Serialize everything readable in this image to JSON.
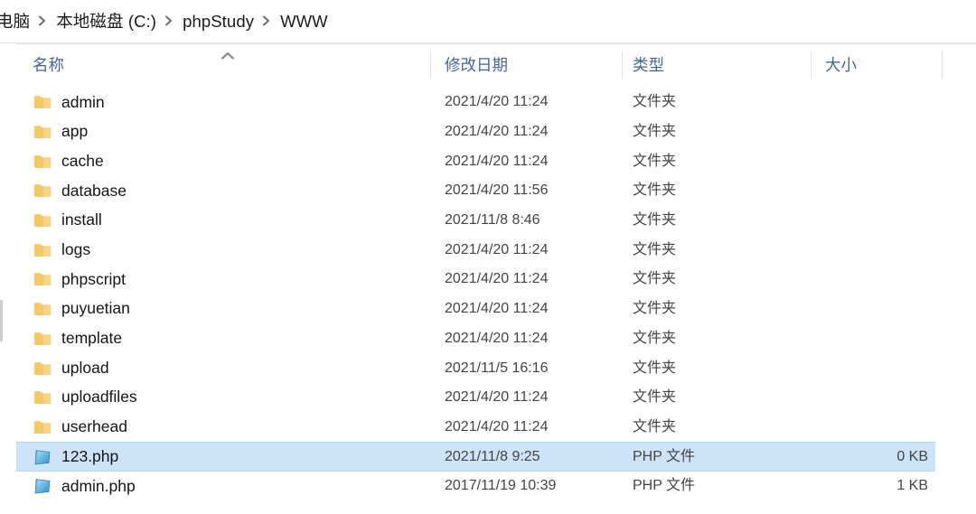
{
  "window": {
    "kind": "windows-file-explorer",
    "selection_color": "#cce3f8",
    "header_text_color": "#45678f",
    "folder_icon_color": "#f6d07f",
    "php_icon_color": "#4fa8d8"
  },
  "breadcrumb": {
    "name": "address-bar",
    "separator": "chevron-right-icon",
    "items": [
      {
        "label": "电脑"
      },
      {
        "label": "本地磁盘 (C:)"
      },
      {
        "label": "phpStudy"
      },
      {
        "label": "WWW"
      }
    ]
  },
  "columns": [
    {
      "key": "name",
      "label": "名称",
      "sorted": "ascending",
      "sort_indicator": "chevron-up-icon"
    },
    {
      "key": "date",
      "label": "修改日期",
      "sorted": "none"
    },
    {
      "key": "type",
      "label": "类型",
      "sorted": "none"
    },
    {
      "key": "size",
      "label": "大小",
      "sorted": "none"
    }
  ],
  "files": [
    {
      "name": "admin",
      "date": "2021/4/20 11:24",
      "type": "文件夹",
      "size": "",
      "icon": "folder-icon",
      "selected": false
    },
    {
      "name": "app",
      "date": "2021/4/20 11:24",
      "type": "文件夹",
      "size": "",
      "icon": "folder-icon",
      "selected": false
    },
    {
      "name": "cache",
      "date": "2021/4/20 11:24",
      "type": "文件夹",
      "size": "",
      "icon": "folder-icon",
      "selected": false
    },
    {
      "name": "database",
      "date": "2021/4/20 11:56",
      "type": "文件夹",
      "size": "",
      "icon": "folder-icon",
      "selected": false
    },
    {
      "name": "install",
      "date": "2021/11/8 8:46",
      "type": "文件夹",
      "size": "",
      "icon": "folder-icon",
      "selected": false
    },
    {
      "name": "logs",
      "date": "2021/4/20 11:24",
      "type": "文件夹",
      "size": "",
      "icon": "folder-icon",
      "selected": false
    },
    {
      "name": "phpscript",
      "date": "2021/4/20 11:24",
      "type": "文件夹",
      "size": "",
      "icon": "folder-icon",
      "selected": false
    },
    {
      "name": "puyuetian",
      "date": "2021/4/20 11:24",
      "type": "文件夹",
      "size": "",
      "icon": "folder-icon",
      "selected": false
    },
    {
      "name": "template",
      "date": "2021/4/20 11:24",
      "type": "文件夹",
      "size": "",
      "icon": "folder-icon",
      "selected": false
    },
    {
      "name": "upload",
      "date": "2021/11/5 16:16",
      "type": "文件夹",
      "size": "",
      "icon": "folder-icon",
      "selected": false
    },
    {
      "name": "uploadfiles",
      "date": "2021/4/20 11:24",
      "type": "文件夹",
      "size": "",
      "icon": "folder-icon",
      "selected": false
    },
    {
      "name": "userhead",
      "date": "2021/4/20 11:24",
      "type": "文件夹",
      "size": "",
      "icon": "folder-icon",
      "selected": false
    },
    {
      "name": "123.php",
      "date": "2021/11/8 9:25",
      "type": "PHP 文件",
      "size": "0 KB",
      "icon": "php-file-icon",
      "selected": true
    },
    {
      "name": "admin.php",
      "date": "2017/11/19 10:39",
      "type": "PHP 文件",
      "size": "1 KB",
      "icon": "php-file-icon",
      "selected": false
    }
  ]
}
